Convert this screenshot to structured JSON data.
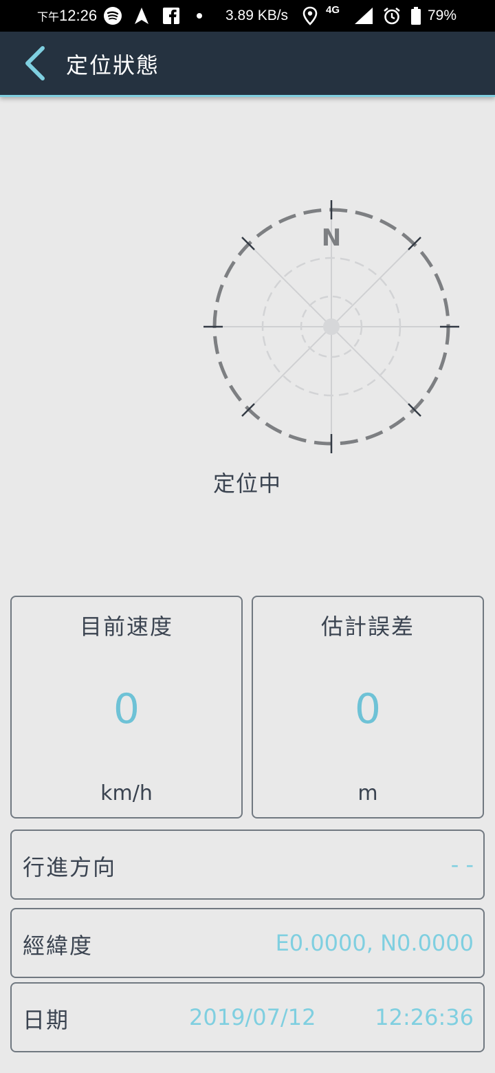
{
  "status_bar": {
    "time_prefix": "下午",
    "time": "12:26",
    "network_speed": "3.89 KB/s",
    "network_type": "4G",
    "battery": "79%"
  },
  "app_bar": {
    "title": "定位狀態"
  },
  "compass": {
    "north_label": "N",
    "status": "定位中"
  },
  "speed_card": {
    "title": "目前速度",
    "value": "0",
    "unit": "km/h"
  },
  "error_card": {
    "title": "估計誤差",
    "value": "0",
    "unit": "m"
  },
  "heading_row": {
    "label": "行進方向",
    "value": "- -"
  },
  "coords_row": {
    "label": "經緯度",
    "value": "E0.0000, N0.0000"
  },
  "date_row": {
    "label": "日期",
    "date": "2019/07/12",
    "time": "12:26:36"
  },
  "colors": {
    "app_bar": "#253240",
    "accent": "#7fcfe0",
    "background": "#e9e9e9",
    "text": "#3a4350"
  }
}
